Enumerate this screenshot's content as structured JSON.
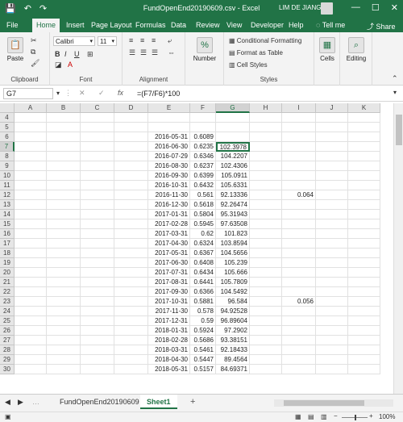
{
  "titlebar": {
    "title": "FundOpenEnd20190609.csv  -  Excel",
    "user": "LIM DE JIANG",
    "save_icon": "💾",
    "undo_icon": "↶",
    "redo_icon": "↷",
    "minimize": "—",
    "maximize": "☐",
    "close": "✕"
  },
  "tabs": [
    "File",
    "Home",
    "Insert",
    "Page Layout",
    "Formulas",
    "Data",
    "Review",
    "View",
    "Developer",
    "Help",
    "Tell me",
    "Share"
  ],
  "ribbon": {
    "clipboard": {
      "paste": "Paste",
      "label": "Clipboard"
    },
    "font": {
      "name": "Calibri",
      "size": "11",
      "label": "Font",
      "bold": "B",
      "italic": "I",
      "underline": "U"
    },
    "alignment": {
      "label": "Alignment"
    },
    "number": {
      "label": "Number",
      "icon": "%"
    },
    "styles": {
      "cond": "Conditional Formatting",
      "table": "Format as Table",
      "cell": "Cell Styles",
      "label": "Styles"
    },
    "cells": {
      "label": "Cells"
    },
    "editing": {
      "label": "Editing"
    }
  },
  "formula_bar": {
    "name_box": "G7",
    "formula": "=(F7/F6)*100",
    "fx": "fx"
  },
  "columns": [
    "A",
    "B",
    "C",
    "D",
    "E",
    "F",
    "G",
    "H",
    "I",
    "J",
    "K"
  ],
  "selected_col": "G",
  "selected_row": "7",
  "rows": [
    {
      "n": "4",
      "E": "",
      "F": "",
      "G": "",
      "I": ""
    },
    {
      "n": "5",
      "E": "",
      "F": "",
      "G": "",
      "I": ""
    },
    {
      "n": "6",
      "E": "2016-05-31",
      "F": "0.6089",
      "G": "",
      "I": ""
    },
    {
      "n": "7",
      "E": "2016-06-30",
      "F": "0.6235",
      "G": "102.3978",
      "I": ""
    },
    {
      "n": "8",
      "E": "2016-07-29",
      "F": "0.6346",
      "G": "104.2207",
      "I": ""
    },
    {
      "n": "9",
      "E": "2016-08-30",
      "F": "0.6237",
      "G": "102.4306",
      "I": ""
    },
    {
      "n": "10",
      "E": "2016-09-30",
      "F": "0.6399",
      "G": "105.0911",
      "I": ""
    },
    {
      "n": "11",
      "E": "2016-10-31",
      "F": "0.6432",
      "G": "105.6331",
      "I": ""
    },
    {
      "n": "12",
      "E": "2016-11-30",
      "F": "0.561",
      "G": "92.13336",
      "I": "0.064"
    },
    {
      "n": "13",
      "E": "2016-12-30",
      "F": "0.5618",
      "G": "92.26474",
      "I": ""
    },
    {
      "n": "14",
      "E": "2017-01-31",
      "F": "0.5804",
      "G": "95.31943",
      "I": ""
    },
    {
      "n": "15",
      "E": "2017-02-28",
      "F": "0.5945",
      "G": "97.63508",
      "I": ""
    },
    {
      "n": "16",
      "E": "2017-03-31",
      "F": "0.62",
      "G": "101.823",
      "I": ""
    },
    {
      "n": "17",
      "E": "2017-04-30",
      "F": "0.6324",
      "G": "103.8594",
      "I": ""
    },
    {
      "n": "18",
      "E": "2017-05-31",
      "F": "0.6367",
      "G": "104.5656",
      "I": ""
    },
    {
      "n": "19",
      "E": "2017-06-30",
      "F": "0.6408",
      "G": "105.239",
      "I": ""
    },
    {
      "n": "20",
      "E": "2017-07-31",
      "F": "0.6434",
      "G": "105.666",
      "I": ""
    },
    {
      "n": "21",
      "E": "2017-08-31",
      "F": "0.6441",
      "G": "105.7809",
      "I": ""
    },
    {
      "n": "22",
      "E": "2017-09-30",
      "F": "0.6366",
      "G": "104.5492",
      "I": ""
    },
    {
      "n": "23",
      "E": "2017-10-31",
      "F": "0.5881",
      "G": "96.584",
      "I": "0.056"
    },
    {
      "n": "24",
      "E": "2017-11-30",
      "F": "0.578",
      "G": "94.92528",
      "I": ""
    },
    {
      "n": "25",
      "E": "2017-12-31",
      "F": "0.59",
      "G": "96.89604",
      "I": ""
    },
    {
      "n": "26",
      "E": "2018-01-31",
      "F": "0.5924",
      "G": "97.2902",
      "I": ""
    },
    {
      "n": "27",
      "E": "2018-02-28",
      "F": "0.5686",
      "G": "93.38151",
      "I": ""
    },
    {
      "n": "28",
      "E": "2018-03-31",
      "F": "0.5461",
      "G": "92.18433",
      "I": ""
    },
    {
      "n": "29",
      "E": "2018-04-30",
      "F": "0.5447",
      "G": "89.4564",
      "I": ""
    },
    {
      "n": "30",
      "E": "2018-05-31",
      "F": "0.5157",
      "G": "84.69371",
      "I": ""
    }
  ],
  "sheets": [
    "FundOpenEnd20190609",
    "Sheet1"
  ],
  "active_sheet": "Sheet1",
  "add_sheet": "+",
  "status": {
    "zoom": "100%"
  }
}
